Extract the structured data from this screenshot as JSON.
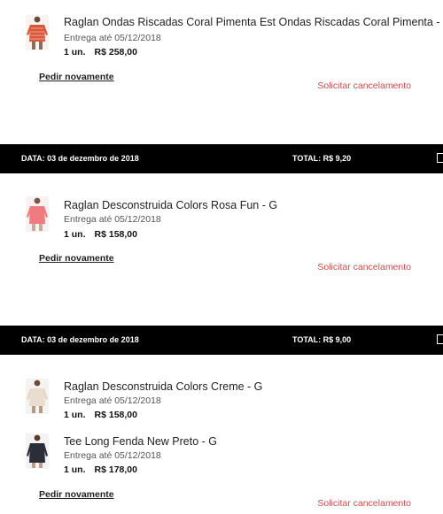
{
  "orders": [
    {
      "items": [
        {
          "name": "Raglan Ondas Riscadas Coral Pimenta Est Ondas Riscadas Coral Pimenta - G",
          "delivery": "Entrega até 05/12/2018",
          "qty": "1 un.",
          "price": "R$ 258,00",
          "thumb_icon": "coral-striped-top-thumbnail",
          "thumb_color": "#d8573c"
        }
      ],
      "reorder_label": "Pedir novamente",
      "cancel_label": "Solicitar cancelamento"
    },
    {
      "date": "DATA: 03 de dezembro de 2018",
      "total": "TOTAL: R$ 9,20",
      "items": [
        {
          "name": "Raglan Desconstruida Colors Rosa Fun - G",
          "delivery": "Entrega até 05/12/2018",
          "qty": "1 un.",
          "price": "R$ 158,00",
          "thumb_icon": "pink-top-thumbnail",
          "thumb_color": "#ef7a80"
        }
      ],
      "reorder_label": "Pedir novamente",
      "cancel_label": "Solicitar cancelamento"
    },
    {
      "date": "DATA: 03 de dezembro de 2018",
      "total": "TOTAL: R$ 9,00",
      "items": [
        {
          "name": "Raglan Desconstruida Colors Creme - G",
          "delivery": "Entrega até 05/12/2018",
          "qty": "1 un.",
          "price": "R$ 158,00",
          "thumb_icon": "cream-top-thumbnail",
          "thumb_color": "#e8ddcf"
        },
        {
          "name": "Tee Long Fenda New Preto - G",
          "delivery": "Entrega até 05/12/2018",
          "qty": "1 un.",
          "price": "R$ 178,00",
          "thumb_icon": "black-tee-thumbnail",
          "thumb_color": "#2b2e38"
        }
      ],
      "reorder_label": "Pedir novamente",
      "cancel_label": "Solicitar cancelamento"
    }
  ],
  "colors": {
    "header_bg": "#000000",
    "header_text": "#ffffff",
    "cancel_link": "#c0504d"
  }
}
